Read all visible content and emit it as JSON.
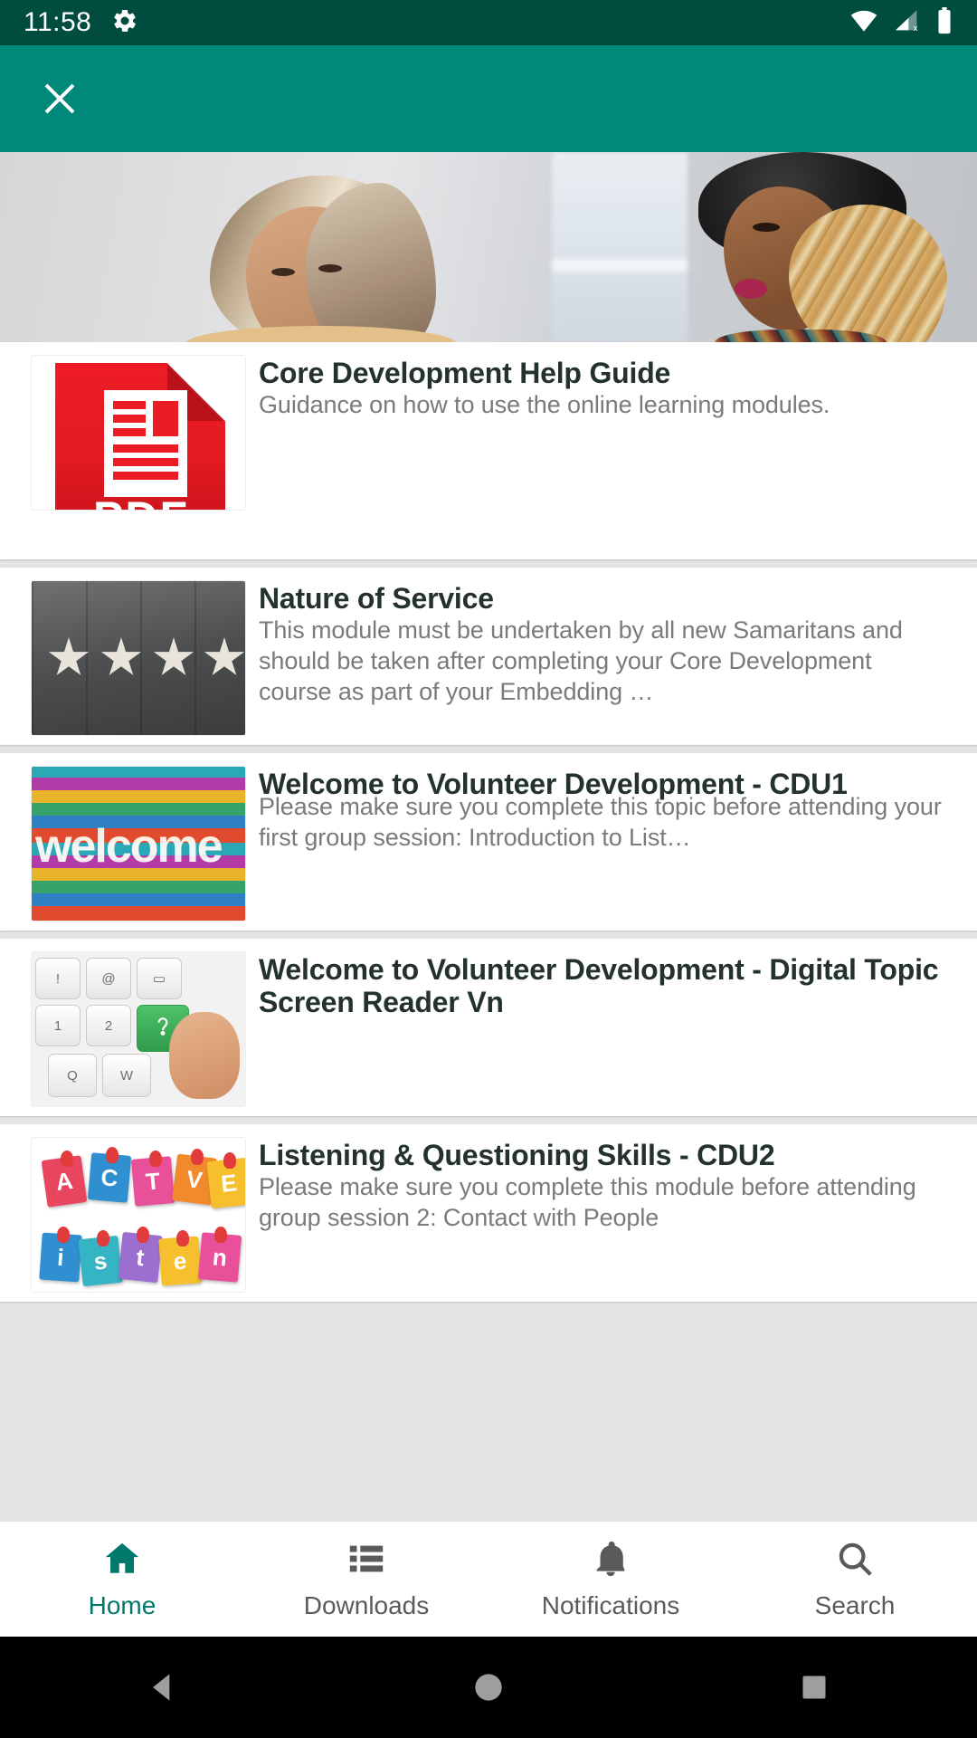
{
  "status_bar": {
    "time": "11:58",
    "icons": [
      "gear-icon",
      "wifi-icon",
      "cellular-signal-off-icon",
      "battery-full-icon"
    ]
  },
  "app_bar": {
    "close_label": "✕"
  },
  "hero": {
    "alt": "two-women-talking-photo"
  },
  "list": {
    "items": [
      {
        "thumb": "pdf-icon",
        "thumb_text": "PDF",
        "title": "Core Development Help Guide",
        "desc": "Guidance on how to use the online learning modules."
      },
      {
        "thumb": "stars-on-slate-photo",
        "title": "Nature of Service",
        "desc": "This module must be undertaken by all new Samaritans and should be taken after completing your Core Development course as part of your Embedding …"
      },
      {
        "thumb": "welcome-mural-photo",
        "thumb_text": "welcome",
        "title": "Welcome to Volunteer Development - CDU1",
        "desc": "Please make sure you complete this topic before attending your first group session: Introduction to List…"
      },
      {
        "thumb": "keyboard-accessibility-photo",
        "title": "Welcome to Volunteer Development - Digital Topic Screen Reader Vn",
        "desc": ""
      },
      {
        "thumb": "active-listening-notes-photo",
        "title": "Listening & Questioning Skills - CDU2",
        "desc": "Please make sure you complete this module before attending group session 2: Contact with People"
      }
    ]
  },
  "bottom_nav": {
    "items": [
      {
        "label": "Home",
        "icon": "home-icon",
        "active": true
      },
      {
        "label": "Downloads",
        "icon": "downloads-list-icon",
        "active": false
      },
      {
        "label": "Notifications",
        "icon": "bell-icon",
        "active": false
      },
      {
        "label": "Search",
        "icon": "search-icon",
        "active": false
      }
    ]
  },
  "android_nav": {
    "back": "back-triangle-icon",
    "home": "home-circle-icon",
    "recents": "recents-square-icon"
  },
  "colors": {
    "status_bar_bg": "#004D40",
    "app_bar_bg": "#00897B",
    "accent": "#00796B",
    "pdf_red": "#EC1C24",
    "title_text": "#23312F",
    "desc_text": "#7A7A7A"
  }
}
